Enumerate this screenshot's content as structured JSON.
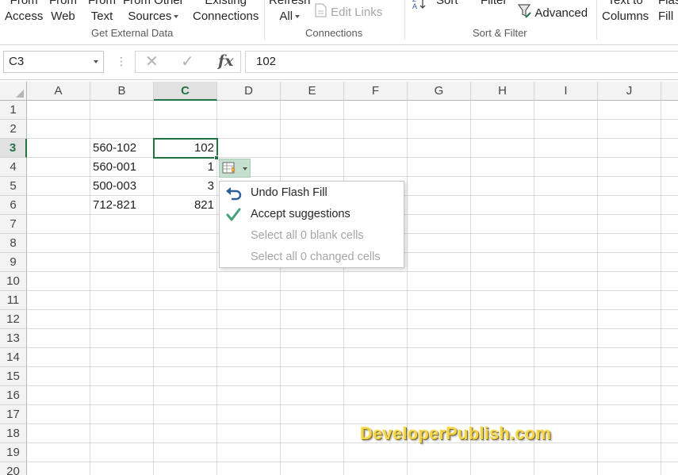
{
  "ribbon": {
    "get_external_data": {
      "buttons": [
        {
          "line1": "From",
          "line2": "Access"
        },
        {
          "line1": "From",
          "line2": "Web"
        },
        {
          "line1": "From",
          "line2": "Text"
        },
        {
          "line1": "From Other",
          "line2": "Sources"
        },
        {
          "line1": "Existing",
          "line2": "Connections"
        }
      ],
      "label": "Get External Data"
    },
    "connections": {
      "refresh_line1": "Refresh",
      "refresh_line2": "All",
      "edit_links": "Edit Links",
      "label": "Connections"
    },
    "sort_filter": {
      "sort": "Sort",
      "filter": "Filter",
      "advanced": "Advanced",
      "label": "Sort & Filter"
    },
    "data_tools": {
      "text_to_line1": "Text to",
      "text_to_line2": "Columns",
      "flash_line1": "Flash",
      "flash_line2": "Fill"
    }
  },
  "formula_bar": {
    "name_box": "C3",
    "fx_label": "fx",
    "value": "102"
  },
  "grid": {
    "columns": [
      "A",
      "B",
      "C",
      "D",
      "E",
      "F",
      "G",
      "H",
      "I",
      "J"
    ],
    "selected_column": "C",
    "rows": [
      "1",
      "2",
      "3",
      "4",
      "5",
      "6",
      "7",
      "8",
      "9",
      "10",
      "11",
      "12",
      "13",
      "14",
      "15",
      "16",
      "17",
      "18",
      "19",
      "20"
    ],
    "selected_row": "3",
    "data_rows": [
      {
        "b": "560-102",
        "c": "102"
      },
      {
        "b": "560-001",
        "c": "1"
      },
      {
        "b": "500-003",
        "c": "3"
      },
      {
        "b": "712-821",
        "c": "821"
      }
    ]
  },
  "flash_fill_menu": {
    "items": [
      {
        "label": "Undo Flash Fill",
        "icon": "undo-icon",
        "enabled": true
      },
      {
        "label": "Accept suggestions",
        "icon": "checkmark-icon",
        "enabled": true
      },
      {
        "label": "Select all 0 blank cells",
        "icon": "",
        "enabled": false
      },
      {
        "label": "Select all 0 changed cells",
        "icon": "",
        "enabled": false
      }
    ]
  },
  "watermark": "DeveloperPublish.com",
  "colors": {
    "excel_green": "#217346",
    "flash_button_bg": "#c6e0cf",
    "disabled_text": "#a6a6a6",
    "watermark_gold": "#f2d44a"
  }
}
